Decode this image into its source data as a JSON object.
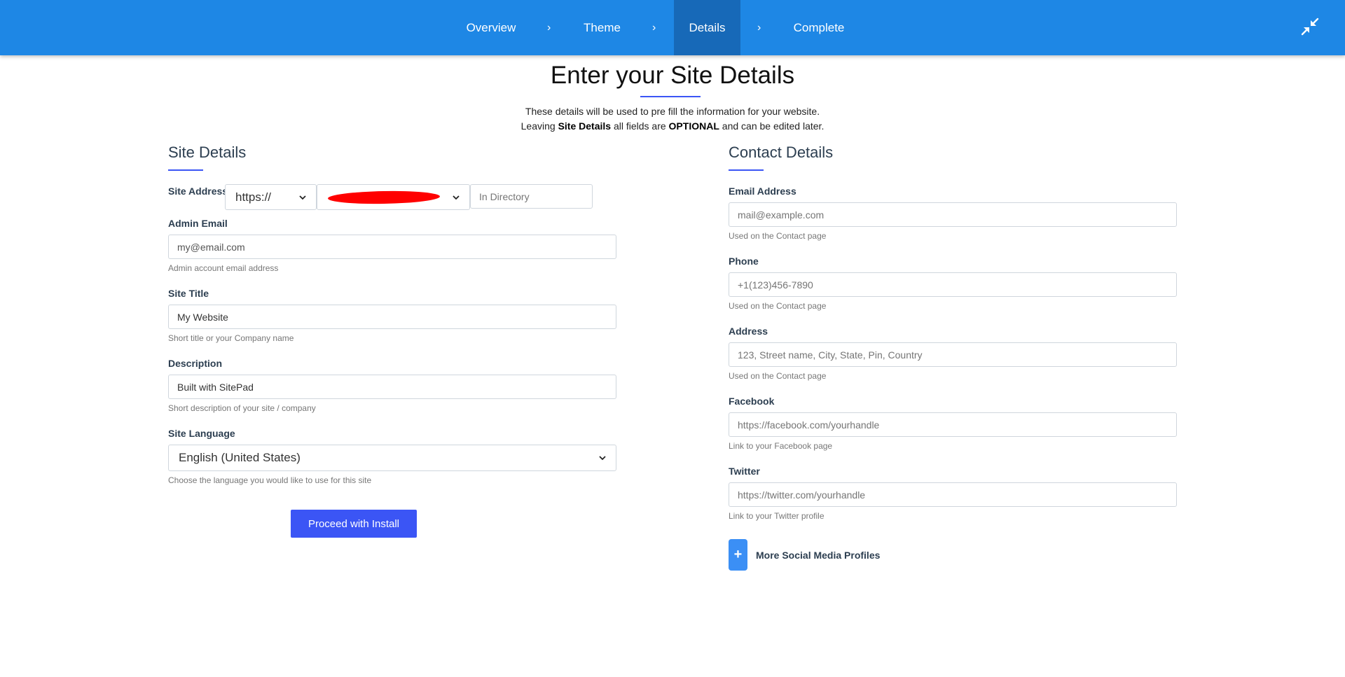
{
  "nav": {
    "steps": [
      "Overview",
      "Theme",
      "Details",
      "Complete"
    ],
    "separator": "›",
    "active_step": "Details"
  },
  "header": {
    "title": "Enter your Site Details",
    "intro_line1": "These details will be used to pre fill the information for your website.",
    "intro_line2_pre": "Leaving ",
    "intro_line2_bold1": "Site Details",
    "intro_line2_mid": " all fields are ",
    "intro_line2_bold2": "OPTIONAL",
    "intro_line2_post": " and can be edited later."
  },
  "site_details": {
    "title": "Site Details",
    "site_address": {
      "label": "Site Address",
      "protocol": "https://",
      "directory_placeholder": "In Directory"
    },
    "admin_email": {
      "label": "Admin Email",
      "value": "my@email.com",
      "help": "Admin account email address"
    },
    "site_title": {
      "label": "Site Title",
      "value": "My Website",
      "help": "Short title or your Company name"
    },
    "description": {
      "label": "Description",
      "value": "Built with SitePad",
      "help": "Short description of your site / company"
    },
    "site_language": {
      "label": "Site Language",
      "value": "English (United States)",
      "help": "Choose the language you would like to use for this site"
    },
    "proceed_label": "Proceed with Install"
  },
  "contact_details": {
    "title": "Contact Details",
    "email": {
      "label": "Email Address",
      "placeholder": "mail@example.com",
      "help": "Used on the Contact page"
    },
    "phone": {
      "label": "Phone",
      "placeholder": "+1(123)456-7890",
      "help": "Used on the Contact page"
    },
    "address": {
      "label": "Address",
      "placeholder": "123, Street name, City, State, Pin, Country",
      "help": "Used on the Contact page"
    },
    "facebook": {
      "label": "Facebook",
      "placeholder": "https://facebook.com/yourhandle",
      "help": "Link to your Facebook page"
    },
    "twitter": {
      "label": "Twitter",
      "placeholder": "https://twitter.com/yourhandle",
      "help": "Link to your Twitter profile"
    },
    "more_social_label": "More Social Media Profiles",
    "plus_symbol": "+"
  },
  "colors": {
    "nav_bg": "#1e87e5",
    "nav_active": "#1769b8",
    "accent": "#3b55f5",
    "redaction": "#ff0000"
  }
}
